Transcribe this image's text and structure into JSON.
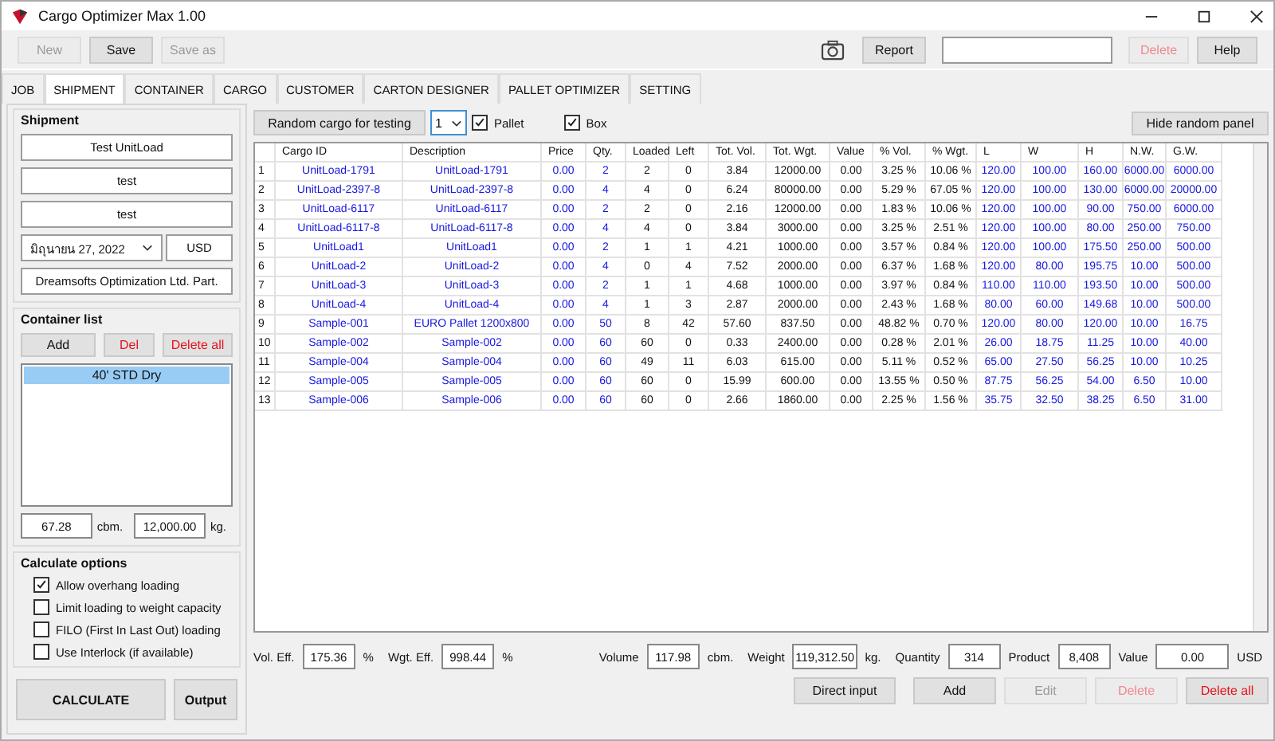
{
  "window": {
    "title": "Cargo Optimizer Max 1.00"
  },
  "toolbar": {
    "buttons": [
      {
        "label": "New",
        "disabled": true,
        "danger": false
      },
      {
        "label": "Save",
        "disabled": false,
        "danger": false
      },
      {
        "label": "Save as",
        "disabled": true,
        "danger": false
      }
    ],
    "right_buttons": [
      {
        "label": "Report",
        "disabled": false,
        "danger": false
      }
    ],
    "end_buttons": [
      {
        "label": "Delete",
        "disabled": true,
        "danger": true
      },
      {
        "label": "Help",
        "disabled": false,
        "danger": false
      }
    ]
  },
  "tabs": [
    {
      "label": "JOB",
      "selected": false
    },
    {
      "label": "SHIPMENT",
      "selected": true
    },
    {
      "label": "CONTAINER",
      "selected": false
    },
    {
      "label": "CARGO",
      "selected": false
    },
    {
      "label": "CUSTOMER",
      "selected": false
    },
    {
      "label": "CARTON DESIGNER",
      "selected": false
    },
    {
      "label": "PALLET OPTIMIZER",
      "selected": false
    },
    {
      "label": "SETTING",
      "selected": false
    }
  ],
  "shipment": {
    "title": "Shipment",
    "name": "Test UnitLoad",
    "field_2": "test",
    "field_3": "test",
    "date": "มิถุนายน 27, 2022",
    "currency": "USD",
    "company": "Dreamsofts Optimization Ltd. Part."
  },
  "container_list": {
    "title": "Container list",
    "buttons": [
      {
        "label": "Add",
        "disabled": false,
        "danger": false
      },
      {
        "label": "Del",
        "disabled": false,
        "danger": true
      },
      {
        "label": "Delete all",
        "disabled": false,
        "danger": true
      }
    ],
    "items": [
      {
        "label": "40' STD Dry",
        "selected": true
      }
    ],
    "volume": "67.28",
    "volume_unit": "cbm.",
    "weight": "12,000.00",
    "weight_unit": "kg."
  },
  "calculate_options": {
    "title": "Calculate options",
    "options": [
      {
        "label": "Allow overhang loading",
        "checked": true
      },
      {
        "label": "Limit loading to weight capacity",
        "checked": false
      },
      {
        "label": "FILO (First In Last Out) loading",
        "checked": false
      },
      {
        "label": "Use Interlock (if available)",
        "checked": false
      }
    ],
    "calculate": "CALCULATE",
    "output": "Output"
  },
  "random_panel": {
    "button": "Random cargo for testing",
    "count": "1",
    "pallet": {
      "label": "Pallet",
      "checked": true
    },
    "box": {
      "label": "Box",
      "checked": true
    },
    "hide": "Hide random panel"
  },
  "table": {
    "columns": [
      {
        "label": "Cargo ID",
        "kind": "input"
      },
      {
        "label": "Description",
        "kind": "input"
      },
      {
        "label": "Price",
        "kind": "input"
      },
      {
        "label": "Qty.",
        "kind": "input"
      },
      {
        "label": "Loaded",
        "kind": "calc"
      },
      {
        "label": "Left",
        "kind": "calc"
      },
      {
        "label": "Tot. Vol.",
        "kind": "calc"
      },
      {
        "label": "Tot. Wgt.",
        "kind": "calc"
      },
      {
        "label": "Value",
        "kind": "calc"
      },
      {
        "label": "% Vol.",
        "kind": "calc"
      },
      {
        "label": "% Wgt.",
        "kind": "calc"
      },
      {
        "label": "L",
        "kind": "input"
      },
      {
        "label": "W",
        "kind": "input"
      },
      {
        "label": "H",
        "kind": "input"
      },
      {
        "label": "N.W.",
        "kind": "input"
      },
      {
        "label": "G.W.",
        "kind": "input"
      }
    ],
    "rows": [
      {
        "number": "1",
        "cells": [
          "UnitLoad-1791",
          "UnitLoad-1791",
          "0.00",
          "2",
          "2",
          "0",
          "3.84",
          "12000.00",
          "0.00",
          "3.25 %",
          "10.06 %",
          "120.00",
          "100.00",
          "160.00",
          "6000.00",
          "6000.00"
        ]
      },
      {
        "number": "2",
        "cells": [
          "UnitLoad-2397-8",
          "UnitLoad-2397-8",
          "0.00",
          "4",
          "4",
          "0",
          "6.24",
          "80000.00",
          "0.00",
          "5.29 %",
          "67.05 %",
          "120.00",
          "100.00",
          "130.00",
          "6000.00",
          "20000.00"
        ]
      },
      {
        "number": "3",
        "cells": [
          "UnitLoad-6117",
          "UnitLoad-6117",
          "0.00",
          "2",
          "2",
          "0",
          "2.16",
          "12000.00",
          "0.00",
          "1.83 %",
          "10.06 %",
          "120.00",
          "100.00",
          "90.00",
          "750.00",
          "6000.00"
        ]
      },
      {
        "number": "4",
        "cells": [
          "UnitLoad-6117-8",
          "UnitLoad-6117-8",
          "0.00",
          "4",
          "4",
          "0",
          "3.84",
          "3000.00",
          "0.00",
          "3.25 %",
          "2.51 %",
          "120.00",
          "100.00",
          "80.00",
          "250.00",
          "750.00"
        ]
      },
      {
        "number": "5",
        "cells": [
          "UnitLoad1",
          "UnitLoad1",
          "0.00",
          "2",
          "1",
          "1",
          "4.21",
          "1000.00",
          "0.00",
          "3.57 %",
          "0.84 %",
          "120.00",
          "100.00",
          "175.50",
          "250.00",
          "500.00"
        ]
      },
      {
        "number": "6",
        "cells": [
          "UnitLoad-2",
          "UnitLoad-2",
          "0.00",
          "4",
          "0",
          "4",
          "7.52",
          "2000.00",
          "0.00",
          "6.37 %",
          "1.68 %",
          "120.00",
          "80.00",
          "195.75",
          "10.00",
          "500.00"
        ]
      },
      {
        "number": "7",
        "cells": [
          "UnitLoad-3",
          "UnitLoad-3",
          "0.00",
          "2",
          "1",
          "1",
          "4.68",
          "1000.00",
          "0.00",
          "3.97 %",
          "0.84 %",
          "110.00",
          "110.00",
          "193.50",
          "10.00",
          "500.00"
        ]
      },
      {
        "number": "8",
        "cells": [
          "UnitLoad-4",
          "UnitLoad-4",
          "0.00",
          "4",
          "1",
          "3",
          "2.87",
          "2000.00",
          "0.00",
          "2.43 %",
          "1.68 %",
          "80.00",
          "60.00",
          "149.68",
          "10.00",
          "500.00"
        ]
      },
      {
        "number": "9",
        "cells": [
          "Sample-001",
          "EURO Pallet 1200x800",
          "0.00",
          "50",
          "8",
          "42",
          "57.60",
          "837.50",
          "0.00",
          "48.82 %",
          "0.70 %",
          "120.00",
          "80.00",
          "120.00",
          "10.00",
          "16.75"
        ]
      },
      {
        "number": "10",
        "cells": [
          "Sample-002",
          "Sample-002",
          "0.00",
          "60",
          "60",
          "0",
          "0.33",
          "2400.00",
          "0.00",
          "0.28 %",
          "2.01 %",
          "26.00",
          "18.75",
          "11.25",
          "10.00",
          "40.00"
        ]
      },
      {
        "number": "11",
        "cells": [
          "Sample-004",
          "Sample-004",
          "0.00",
          "60",
          "49",
          "11",
          "6.03",
          "615.00",
          "0.00",
          "5.11 %",
          "0.52 %",
          "65.00",
          "27.50",
          "56.25",
          "10.00",
          "10.25"
        ]
      },
      {
        "number": "12",
        "cells": [
          "Sample-005",
          "Sample-005",
          "0.00",
          "60",
          "60",
          "0",
          "15.99",
          "600.00",
          "0.00",
          "13.55 %",
          "0.50 %",
          "87.75",
          "56.25",
          "54.00",
          "6.50",
          "10.00"
        ]
      },
      {
        "number": "13",
        "cells": [
          "Sample-006",
          "Sample-006",
          "0.00",
          "60",
          "60",
          "0",
          "2.66",
          "1860.00",
          "0.00",
          "2.25 %",
          "1.56 %",
          "35.75",
          "32.50",
          "38.25",
          "6.50",
          "31.00"
        ]
      }
    ]
  },
  "summary": [
    {
      "label": "Vol. Eff.",
      "value": "175.36",
      "unit": "%"
    },
    {
      "label": "Wgt. Eff.",
      "value": "998.44",
      "unit": "%"
    },
    {
      "label": "Volume",
      "value": "117.98",
      "unit": "cbm."
    },
    {
      "label": "Weight",
      "value": "119,312.50",
      "unit": "kg."
    },
    {
      "label": "Quantity",
      "value": "314"
    },
    {
      "label": "Product",
      "value": "8,408"
    },
    {
      "label": "Value",
      "value": "0.00",
      "unit": "USD"
    }
  ],
  "bottom_buttons": [
    {
      "label": "Direct input",
      "disabled": false,
      "danger": false
    },
    {
      "label": "Add",
      "disabled": false,
      "danger": false
    },
    {
      "label": "Edit",
      "disabled": true,
      "danger": false
    },
    {
      "label": "Delete",
      "disabled": true,
      "danger": true
    },
    {
      "label": "Delete all",
      "disabled": false,
      "danger": true
    }
  ]
}
